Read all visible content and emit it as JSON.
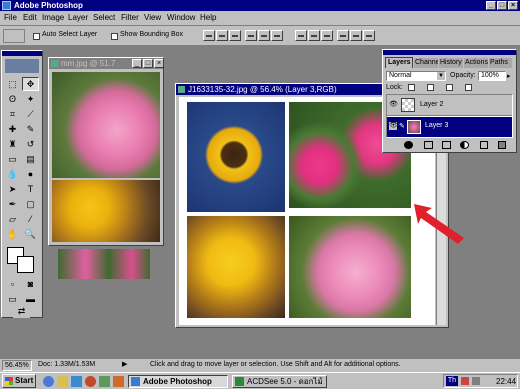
{
  "app": {
    "title": "Adobe Photoshop"
  },
  "menu": [
    "File",
    "Edit",
    "Image",
    "Layer",
    "Select",
    "Filter",
    "View",
    "Window",
    "Help"
  ],
  "options": {
    "auto_select": "Auto Select Layer",
    "show_bounding": "Show Bounding Box"
  },
  "documents": {
    "small": {
      "title": "mm.jpg @ 51.7"
    },
    "main": {
      "title": "J1633135-32.jpg @ 56.4% (Layer 3,RGB)"
    }
  },
  "layers_panel": {
    "tabs": [
      "Layers",
      "Channels",
      "History",
      "Actions",
      "Paths"
    ],
    "blend_mode": "Normal",
    "opacity_label": "Opacity:",
    "opacity_value": "100%",
    "lock_label": "Lock:",
    "layers": [
      {
        "name": "Layer 2",
        "selected": false
      },
      {
        "name": "Layer 3",
        "selected": true
      }
    ]
  },
  "status": {
    "zoom": "56.45%",
    "doc": "Doc: 1.33M/1.53M",
    "hint": "Click and drag to move layer or selection. Use Shift and Alt for additional options."
  },
  "taskbar": {
    "start": "Start",
    "items": [
      "Adobe Photoshop",
      "ACDSee 5.0 - ดอกไม้"
    ],
    "clock": "22:44",
    "tray_label": "Th"
  },
  "colors": {
    "title_active": "#000080",
    "chrome": "#c0c0c0",
    "desktop": "#808080",
    "arrow": "#e0202a"
  }
}
